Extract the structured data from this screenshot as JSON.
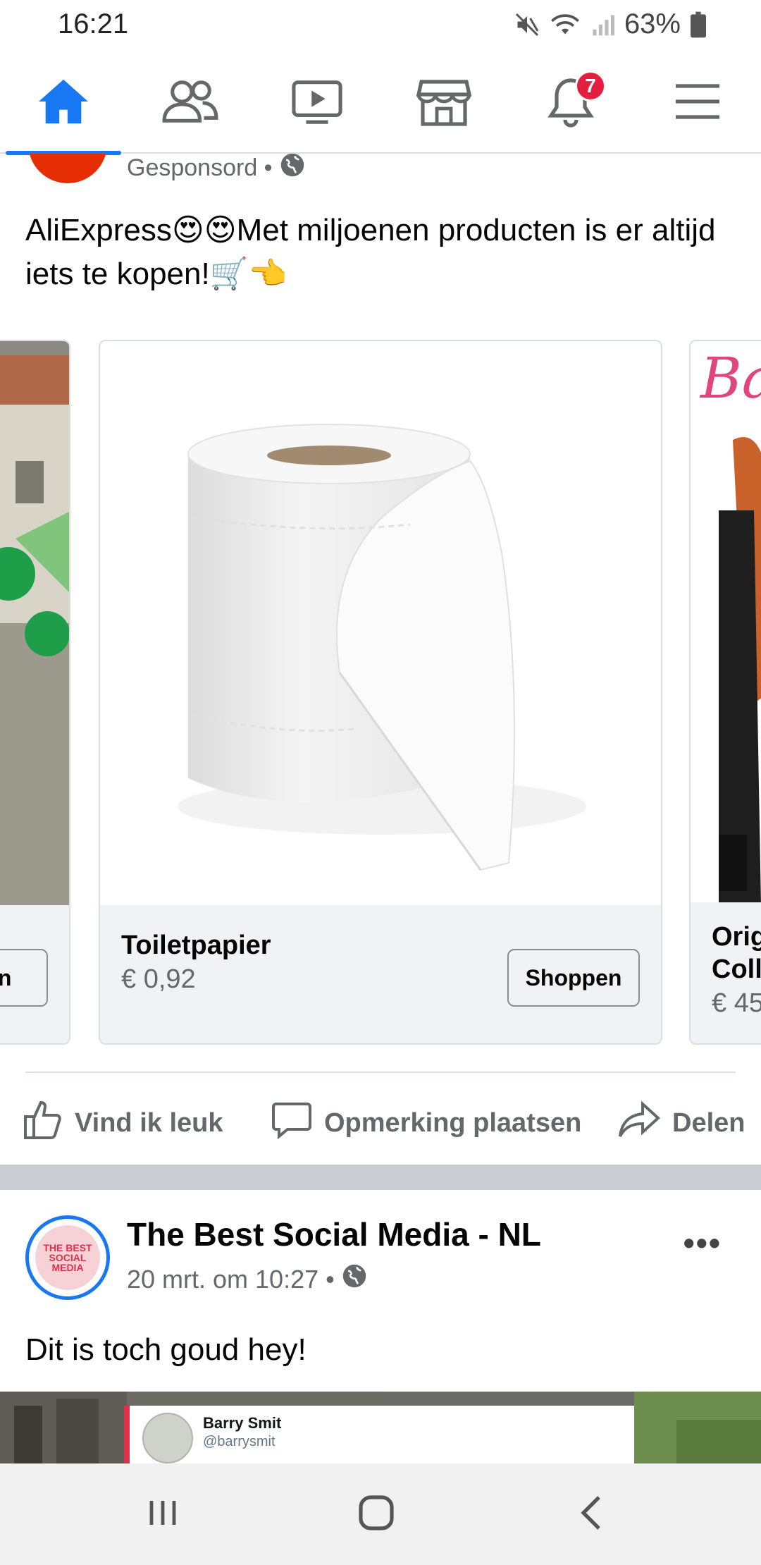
{
  "status_bar": {
    "time": "16:21",
    "battery_percent": "63%",
    "icons": [
      "mute-icon",
      "wifi-icon",
      "signal-icon",
      "battery-icon"
    ]
  },
  "top_nav": {
    "tabs": [
      {
        "id": "home",
        "icon": "home-icon",
        "active": true
      },
      {
        "id": "friends",
        "icon": "friends-icon",
        "active": false
      },
      {
        "id": "watch",
        "icon": "video-icon",
        "active": false
      },
      {
        "id": "marketplace",
        "icon": "marketplace-icon",
        "active": false
      },
      {
        "id": "notifications",
        "icon": "bell-icon",
        "active": false,
        "badge": "7"
      },
      {
        "id": "menu",
        "icon": "hamburger-icon",
        "active": false
      }
    ],
    "accent_color": "#1877f2",
    "badge_color": "#e41e3f"
  },
  "post1": {
    "sponsored_label": "Gesponsord •",
    "text": "AliExpress😍😍Met miljoenen producten is er altijd iets te kopen!🛒👈",
    "carousel": {
      "cards": [
        {
          "title": "",
          "price": "",
          "button": "pen"
        },
        {
          "title": "Toiletpapier",
          "price": "€ 0,92",
          "button": "Shoppen"
        },
        {
          "title": "Orig\nColl",
          "price": "€ 45",
          "button": ""
        }
      ]
    },
    "actions": {
      "like": "Vind ik leuk",
      "comment": "Opmerking plaatsen",
      "share": "Delen"
    }
  },
  "post2": {
    "page_name": "The Best Social Media - NL",
    "meta": "20 mrt. om 10:27 •",
    "text": "Dit is toch goud hey!",
    "avatar_text": "THE BEST SOCIAL MEDIA",
    "more": "•••",
    "tweet": {
      "name": "Barry Smit",
      "handle": "@barrysmit"
    }
  }
}
